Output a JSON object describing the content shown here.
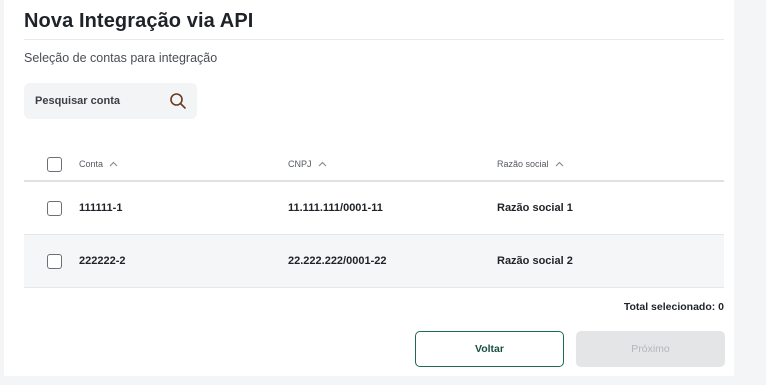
{
  "page": {
    "title": "Nova Integração via API",
    "subtitle": "Seleção de contas para integração"
  },
  "search": {
    "placeholder": "Pesquisar conta",
    "icon": "search-icon"
  },
  "table": {
    "columns": [
      "Conta",
      "CNPJ",
      "Razão social"
    ],
    "sort_icon": "chevron-up-icon",
    "rows": [
      {
        "conta": "111111-1",
        "cnpj": "11.111.111/0001-11",
        "razao": "Razão social 1",
        "selected": false
      },
      {
        "conta": "222222-2",
        "cnpj": "22.222.222/0001-22",
        "razao": "Razão social 2",
        "selected": false
      }
    ]
  },
  "footer": {
    "total_label": "Total selecionado: 0",
    "back_label": "Voltar",
    "next_label": "Próximo"
  },
  "colors": {
    "accent": "#1b6b55",
    "disabled_bg": "#e4e5e7",
    "disabled_text": "#b3b6ba"
  }
}
